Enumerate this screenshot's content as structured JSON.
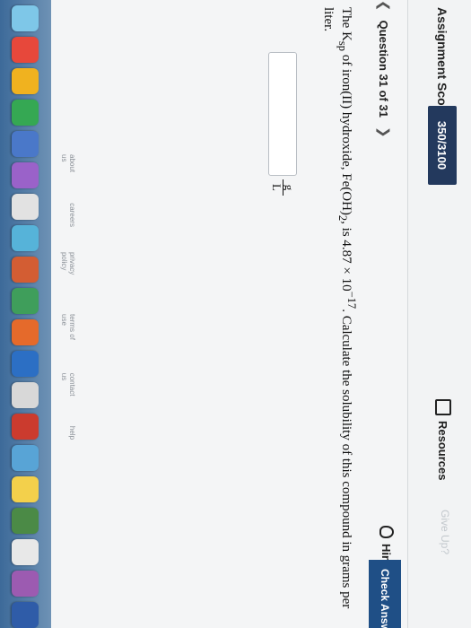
{
  "header": {
    "score_label": "Assignment Score:",
    "score_value": "350/3100",
    "resources_label": "Resources",
    "give_up_label": "Give Up?"
  },
  "nav": {
    "prev_icon": "chevron-left-icon",
    "question_label": "Question 31 of 31",
    "next_icon": "chevron-right-icon",
    "hint_label": "Hint",
    "check_label": "Check Answ"
  },
  "question": {
    "text_before": "The K",
    "sub": "sp",
    "text_middle": " of iron(II) hydroxide, Fe(OH)",
    "sub2": "2",
    "text_middle2": ", is 4.87 × 10",
    "sup": "−17",
    "text_after": ". Calculate the solubility of this compound in grams per liter.",
    "answer_value": "",
    "unit_numerator": "g",
    "unit_denominator": "L"
  },
  "footer": {
    "links": [
      "about us",
      "careers",
      "privacy policy",
      "terms of use",
      "contact us",
      "help"
    ]
  },
  "taskbar": {
    "colors": [
      "#7ec7e8",
      "#e7483b",
      "#f0b21f",
      "#35a853",
      "#4a78c9",
      "#9a62c9",
      "#e2e2e2",
      "#56b3d9",
      "#d35d33",
      "#3f9e5b",
      "#e56a2b",
      "#2c6fc4",
      "#d8d8d8",
      "#cb3b2e",
      "#58a4d6",
      "#f3d04b",
      "#4b8a46",
      "#e8e8e8",
      "#9c5bb1",
      "#2f5ca8"
    ]
  }
}
